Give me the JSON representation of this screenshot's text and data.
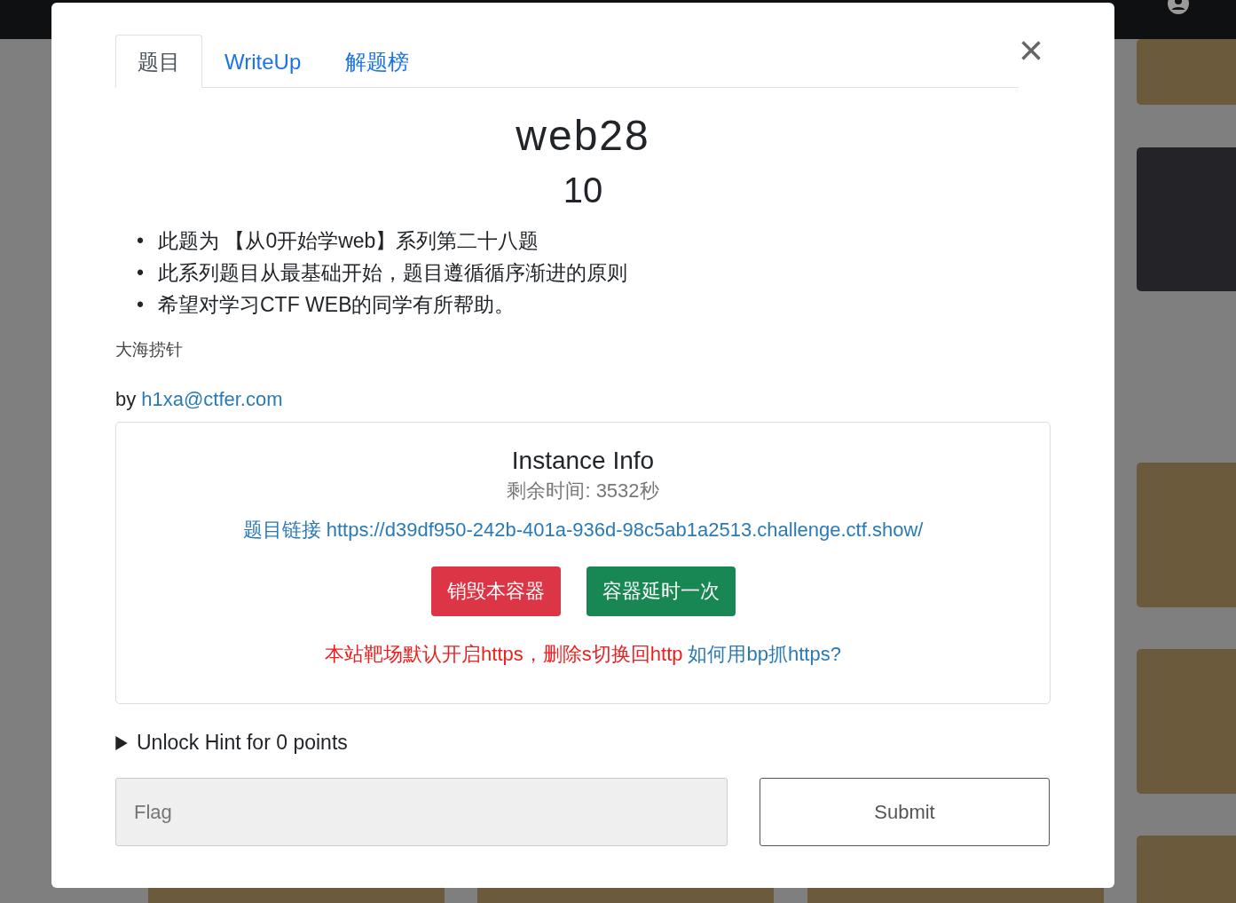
{
  "tabs": [
    {
      "label": "题目",
      "selected": true
    },
    {
      "label": "WriteUp",
      "selected": false
    },
    {
      "label": "解题榜",
      "selected": false
    }
  ],
  "close_button": "×",
  "challenge": {
    "name": "web28",
    "points": "10",
    "description": [
      {
        "bullet": "•",
        "text": "此题为 【从0开始学web】系列第二十八题"
      },
      {
        "bullet": "•",
        "text": "此系列题目从最基础开始，题目遵循循序渐进的原则"
      },
      {
        "bullet": "•",
        "text": "希望对学习CTF WEB的同学有所帮助。"
      }
    ],
    "hint_text": "大海捞针",
    "author_prefix": "by",
    "author_link": "h1xa@ctfer.com"
  },
  "instance": {
    "title": "Instance Info",
    "remaining": "剩余时间: 3532秒",
    "link_label": "题目链接",
    "link_url": "https://d39df950-242b-401a-936d-98c5ab1a2513.challenge.ctf.show/",
    "buttons": [
      {
        "label": "销毁本容器",
        "kind": "danger"
      },
      {
        "label": "容器延时一次",
        "kind": "success"
      }
    ],
    "notice": "本站靶场默认开启https，删除s切换回http",
    "notice_link": "如何用bp抓https?"
  },
  "hint": {
    "label": "Unlock Hint for 0 points",
    "expanded": false
  },
  "flag": {
    "placeholder": "Flag"
  },
  "submit": "Submit"
}
